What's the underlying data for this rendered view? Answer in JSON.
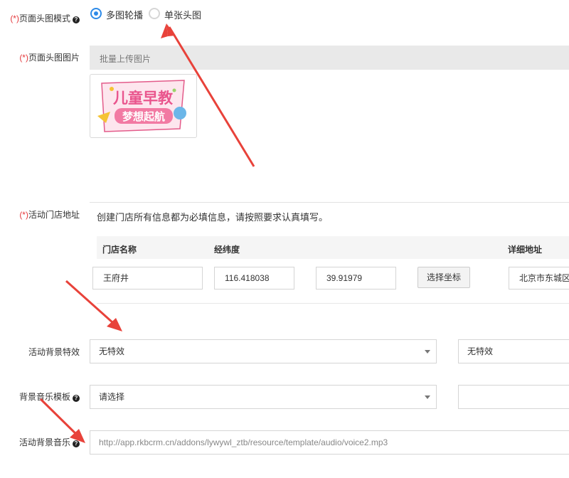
{
  "form": {
    "header_mode": {
      "required_mark": "(*)",
      "label": "页面头图模式",
      "options": [
        {
          "label": "多图轮播",
          "selected": true
        },
        {
          "label": "单张头图",
          "selected": false
        }
      ]
    },
    "header_image": {
      "required_mark": "(*)",
      "label": "页面头图图片",
      "upload_button": "批量上传图片",
      "thumbnail": {
        "line1": "儿童早教",
        "line2": "梦想起航"
      }
    },
    "store_address": {
      "required_mark": "(*)",
      "label": "活动门店地址",
      "notice": "创建门店所有信息都为必填信息，请按照要求认真填写。",
      "columns": [
        "门店名称",
        "经纬度",
        "详细地址"
      ],
      "row": {
        "name": "王府井",
        "longitude": "116.418038",
        "latitude": "39.91979",
        "pick_button": "选择坐标",
        "address": "北京市东城区"
      }
    },
    "bg_effect": {
      "label": "活动背景特效",
      "value": "无特效",
      "value2": "无特效"
    },
    "bg_music_template": {
      "label": "背景音乐模板",
      "value": "请选择"
    },
    "bg_music": {
      "label": "活动背景音乐",
      "value": "http://app.rkbcrm.cn/addons/lywywl_ztb/resource/template/audio/voice2.mp3"
    }
  },
  "help_icon": "question-circle-icon",
  "colors": {
    "accent": "#2d8ae8",
    "required": "#e4393c",
    "annotation_arrow": "#e8423a"
  }
}
